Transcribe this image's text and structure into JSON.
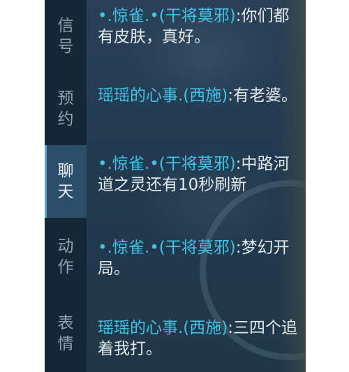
{
  "sidebar": {
    "tabs": [
      {
        "label": "信号",
        "active": false
      },
      {
        "label": "预约",
        "active": false
      },
      {
        "label": "聊天",
        "active": true
      },
      {
        "label": "动作",
        "active": false
      },
      {
        "label": "表情",
        "active": false
      }
    ]
  },
  "messages": [
    {
      "prefix": "•",
      "sender": ".惊雀.•(干将莫邪)",
      "text": ":你们都有皮肤，真好。"
    },
    {
      "prefix": "",
      "sender": "瑶瑶的心事.(西施)",
      "text": ":有老婆。"
    },
    {
      "prefix": "•",
      "sender": ".惊雀.•(干将莫邪)",
      "text": ":中路河道之灵还有10秒刷新"
    },
    {
      "prefix": "•",
      "sender": ".惊雀.•(干将莫邪)",
      "text": ":梦幻开局。"
    },
    {
      "prefix": "",
      "sender": "瑶瑶的心事.(西施)",
      "text": ":三四个追着我打。"
    }
  ],
  "colors": {
    "sender": "#3fc2e6",
    "text": "#e3e8ea",
    "active_tab": "#2d4e69"
  }
}
